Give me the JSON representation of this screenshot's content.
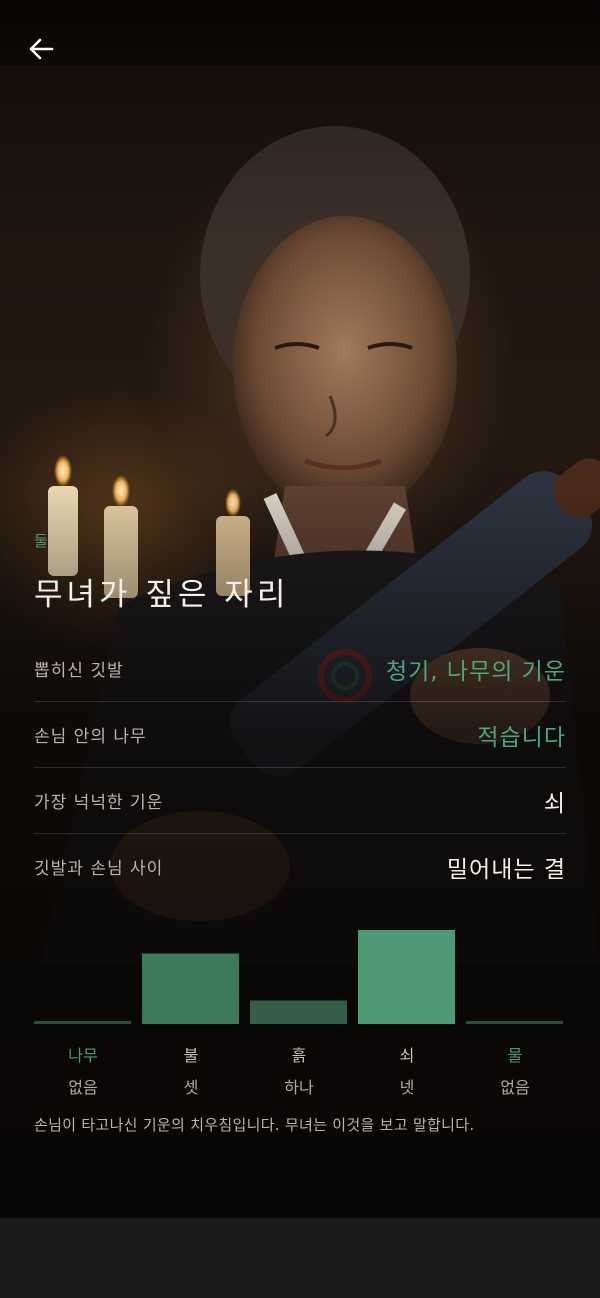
{
  "header": {
    "back_icon": "arrow-left-icon"
  },
  "section": {
    "eyebrow": "둘",
    "title": "무녀가 짚은 자리"
  },
  "details": [
    {
      "label": "뽑히신 깃발",
      "value": "청기, 나무의 기운",
      "accent": true
    },
    {
      "label": "손님 안의 나무",
      "value": "적습니다",
      "accent": true
    },
    {
      "label": "가장 넉넉한 기운",
      "value": "쇠",
      "accent": false
    },
    {
      "label": "깃발과 손님 사이",
      "value": "밀어내는 결",
      "accent": false
    }
  ],
  "chart_data": {
    "type": "bar",
    "categories": [
      "나무",
      "불",
      "흙",
      "쇠",
      "물"
    ],
    "values": [
      0,
      3,
      1,
      4,
      0
    ],
    "value_labels": [
      "없음",
      "셋",
      "하나",
      "넷",
      "없음"
    ],
    "max": 4,
    "highlight_category": [
      "나무",
      "물"
    ],
    "colors": {
      "accent": "#4f9a74",
      "bar": "#3c7a59",
      "bar_strong": "#4f9a74",
      "bar_dim": "#355e48",
      "baseline": "#2b4f3e"
    }
  },
  "footnote": "손님이 타고나신 기운의 치우침입니다. 무녀는 이것을 보고 말합니다."
}
